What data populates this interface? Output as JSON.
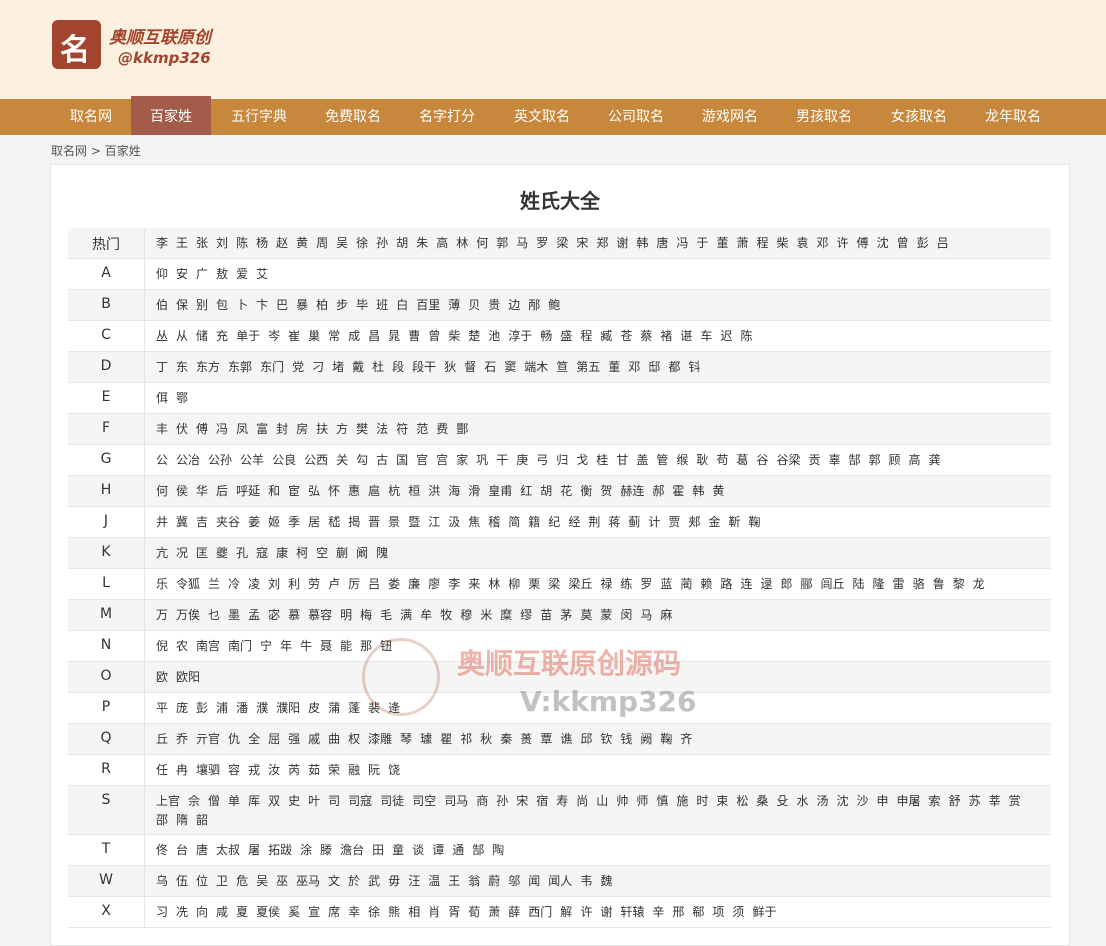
{
  "site": {
    "logo_glyph": "名",
    "logo_title": "奥顺互联原创",
    "logo_sub": "@kkmp326"
  },
  "nav": [
    {
      "label": "取名网",
      "active": false
    },
    {
      "label": "百家姓",
      "active": true
    },
    {
      "label": "五行字典",
      "active": false
    },
    {
      "label": "免费取名",
      "active": false
    },
    {
      "label": "名字打分",
      "active": false
    },
    {
      "label": "英文取名",
      "active": false
    },
    {
      "label": "公司取名",
      "active": false
    },
    {
      "label": "游戏网名",
      "active": false
    },
    {
      "label": "男孩取名",
      "active": false
    },
    {
      "label": "女孩取名",
      "active": false
    },
    {
      "label": "龙年取名",
      "active": false
    }
  ],
  "breadcrumb": {
    "home": "取名网",
    "sep": ">",
    "current": "百家姓"
  },
  "page_title": "姓氏大全",
  "rows": [
    {
      "key": "热门",
      "names": [
        "李",
        "王",
        "张",
        "刘",
        "陈",
        "杨",
        "赵",
        "黄",
        "周",
        "吴",
        "徐",
        "孙",
        "胡",
        "朱",
        "高",
        "林",
        "何",
        "郭",
        "马",
        "罗",
        "梁",
        "宋",
        "郑",
        "谢",
        "韩",
        "唐",
        "冯",
        "于",
        "董",
        "萧",
        "程",
        "柴",
        "袁",
        "邓",
        "许",
        "傅",
        "沈",
        "曾",
        "彭",
        "吕"
      ]
    },
    {
      "key": "A",
      "names": [
        "仰",
        "安",
        "广",
        "敖",
        "爱",
        "艾"
      ]
    },
    {
      "key": "B",
      "names": [
        "伯",
        "保",
        "别",
        "包",
        "卜",
        "卞",
        "巴",
        "暴",
        "柏",
        "步",
        "毕",
        "班",
        "白",
        "百里",
        "薄",
        "贝",
        "贵",
        "边",
        "邴",
        "鲍"
      ]
    },
    {
      "key": "C",
      "names": [
        "丛",
        "从",
        "储",
        "充",
        "单于",
        "岑",
        "崔",
        "巢",
        "常",
        "成",
        "昌",
        "晁",
        "曹",
        "曾",
        "柴",
        "楚",
        "池",
        "淳于",
        "畅",
        "盛",
        "程",
        "臧",
        "苍",
        "蔡",
        "褚",
        "谌",
        "车",
        "迟",
        "陈"
      ]
    },
    {
      "key": "D",
      "names": [
        "丁",
        "东",
        "东方",
        "东郭",
        "东门",
        "党",
        "刁",
        "堵",
        "戴",
        "杜",
        "段",
        "段干",
        "狄",
        "督",
        "石",
        "窦",
        "端木",
        "笪",
        "第五",
        "董",
        "邓",
        "邸",
        "都",
        "钭"
      ]
    },
    {
      "key": "E",
      "names": [
        "佴",
        "鄂"
      ]
    },
    {
      "key": "F",
      "names": [
        "丰",
        "伏",
        "傅",
        "冯",
        "凤",
        "富",
        "封",
        "房",
        "扶",
        "方",
        "樊",
        "法",
        "符",
        "范",
        "费",
        "酆"
      ]
    },
    {
      "key": "G",
      "names": [
        "公",
        "公冶",
        "公孙",
        "公羊",
        "公良",
        "公西",
        "关",
        "勾",
        "古",
        "国",
        "官",
        "宫",
        "家",
        "巩",
        "干",
        "庚",
        "弓",
        "归",
        "戈",
        "桂",
        "甘",
        "盖",
        "管",
        "缑",
        "耿",
        "苟",
        "葛",
        "谷",
        "谷梁",
        "贡",
        "辜",
        "郜",
        "郭",
        "顾",
        "高",
        "龚"
      ]
    },
    {
      "key": "H",
      "names": [
        "何",
        "侯",
        "华",
        "后",
        "呼延",
        "和",
        "宦",
        "弘",
        "怀",
        "惠",
        "扈",
        "杭",
        "桓",
        "洪",
        "海",
        "滑",
        "皇甫",
        "红",
        "胡",
        "花",
        "衡",
        "贺",
        "赫连",
        "郝",
        "霍",
        "韩",
        "黄"
      ]
    },
    {
      "key": "J",
      "names": [
        "井",
        "冀",
        "吉",
        "夹谷",
        "姜",
        "姬",
        "季",
        "居",
        "嵇",
        "揭",
        "晋",
        "景",
        "暨",
        "江",
        "汲",
        "焦",
        "稽",
        "简",
        "籍",
        "纪",
        "经",
        "荆",
        "蒋",
        "蓟",
        "计",
        "贾",
        "郏",
        "金",
        "靳",
        "鞠"
      ]
    },
    {
      "key": "K",
      "names": [
        "亢",
        "况",
        "匡",
        "夔",
        "孔",
        "寇",
        "康",
        "柯",
        "空",
        "蒯",
        "阚",
        "隗"
      ]
    },
    {
      "key": "L",
      "names": [
        "乐",
        "令狐",
        "兰",
        "冷",
        "凌",
        "刘",
        "利",
        "劳",
        "卢",
        "厉",
        "吕",
        "娄",
        "廉",
        "廖",
        "李",
        "来",
        "林",
        "柳",
        "栗",
        "梁",
        "梁丘",
        "禄",
        "练",
        "罗",
        "蓝",
        "蔺",
        "赖",
        "路",
        "连",
        "逯",
        "郎",
        "郦",
        "闾丘",
        "陆",
        "隆",
        "雷",
        "骆",
        "鲁",
        "黎",
        "龙"
      ]
    },
    {
      "key": "M",
      "names": [
        "万",
        "万俟",
        "乜",
        "墨",
        "孟",
        "宓",
        "慕",
        "慕容",
        "明",
        "梅",
        "毛",
        "满",
        "牟",
        "牧",
        "穆",
        "米",
        "糜",
        "缪",
        "苗",
        "茅",
        "莫",
        "蒙",
        "闵",
        "马",
        "麻"
      ]
    },
    {
      "key": "N",
      "names": [
        "倪",
        "农",
        "南宫",
        "南门",
        "宁",
        "年",
        "牛",
        "聂",
        "能",
        "那",
        "钮"
      ]
    },
    {
      "key": "O",
      "names": [
        "欧",
        "欧阳"
      ]
    },
    {
      "key": "P",
      "names": [
        "平",
        "庞",
        "彭",
        "浦",
        "潘",
        "濮",
        "濮阳",
        "皮",
        "蒲",
        "蓬",
        "裴",
        "逄"
      ]
    },
    {
      "key": "Q",
      "names": [
        "丘",
        "乔",
        "亓官",
        "仇",
        "全",
        "屈",
        "强",
        "戚",
        "曲",
        "权",
        "漆雕",
        "琴",
        "璩",
        "瞿",
        "祁",
        "秋",
        "秦",
        "蒉",
        "覃",
        "谯",
        "邱",
        "钦",
        "钱",
        "阙",
        "鞠",
        "齐"
      ]
    },
    {
      "key": "R",
      "names": [
        "任",
        "冉",
        "壤驷",
        "容",
        "戎",
        "汝",
        "芮",
        "茹",
        "荣",
        "融",
        "阮",
        "饶"
      ]
    },
    {
      "key": "S",
      "names": [
        "上官",
        "佘",
        "僧",
        "单",
        "厍",
        "双",
        "史",
        "叶",
        "司",
        "司寇",
        "司徒",
        "司空",
        "司马",
        "商",
        "孙",
        "宋",
        "宿",
        "寿",
        "尚",
        "山",
        "帅",
        "师",
        "慎",
        "施",
        "时",
        "束",
        "松",
        "桑",
        "殳",
        "水",
        "汤",
        "沈",
        "沙",
        "申",
        "申屠",
        "索",
        "舒",
        "苏",
        "莘",
        "赏",
        "邵",
        "隋",
        "韶"
      ]
    },
    {
      "key": "T",
      "names": [
        "佟",
        "台",
        "唐",
        "太叔",
        "屠",
        "拓跋",
        "涂",
        "滕",
        "澹台",
        "田",
        "童",
        "谈",
        "谭",
        "通",
        "郜",
        "陶"
      ]
    },
    {
      "key": "W",
      "names": [
        "乌",
        "伍",
        "位",
        "卫",
        "危",
        "吴",
        "巫",
        "巫马",
        "文",
        "於",
        "武",
        "毋",
        "汪",
        "温",
        "王",
        "翁",
        "蔚",
        "邬",
        "闻",
        "闻人",
        "韦",
        "魏"
      ]
    },
    {
      "key": "X",
      "names": [
        "习",
        "冼",
        "向",
        "咸",
        "夏",
        "夏侯",
        "奚",
        "宣",
        "席",
        "幸",
        "徐",
        "熊",
        "相",
        "肖",
        "胥",
        "荀",
        "萧",
        "薛",
        "西门",
        "解",
        "许",
        "谢",
        "轩辕",
        "辛",
        "邢",
        "郗",
        "项",
        "须",
        "鲜于"
      ]
    }
  ],
  "watermark": {
    "line1": "奥顺互联原创源码",
    "line2": "V:kkmp326"
  }
}
